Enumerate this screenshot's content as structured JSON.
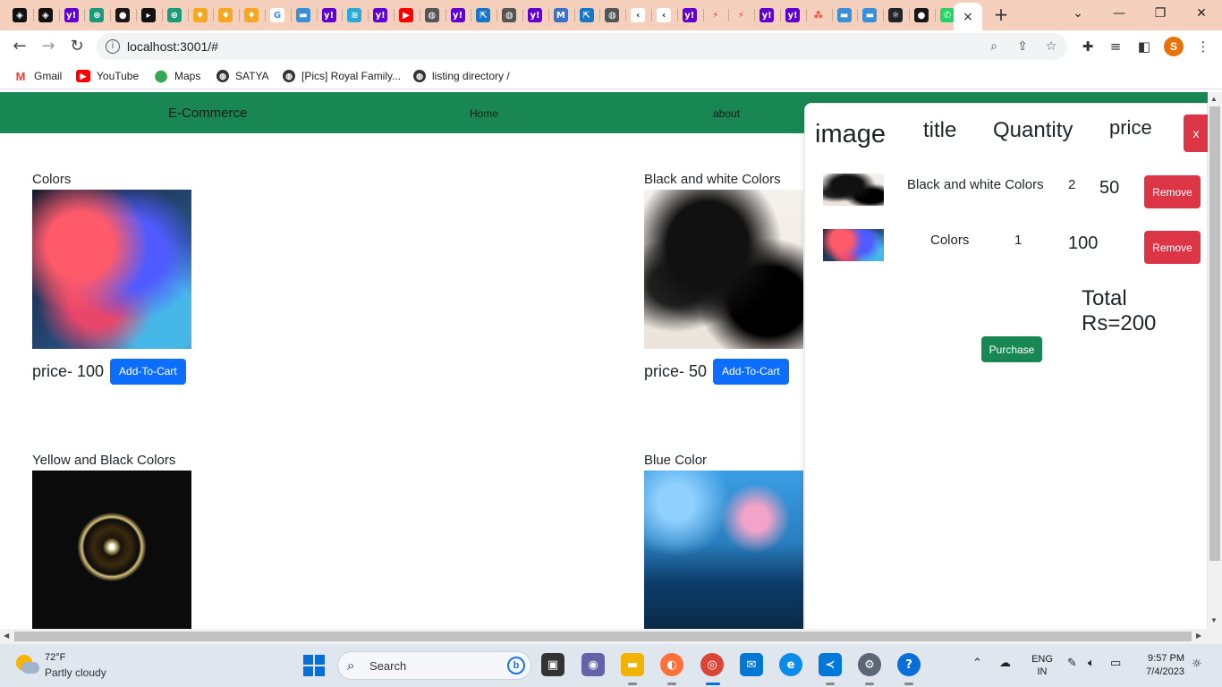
{
  "browser": {
    "tab_icons": [
      "codepen-icon",
      "codepen-icon",
      "yahoo-icon",
      "openai-icon",
      "github-icon",
      "terminal-icon",
      "openai-icon",
      "fire-icon",
      "fire-icon",
      "fire-icon",
      "google-icon",
      "bar-icon",
      "yahoo-icon",
      "wave-icon",
      "yahoo-icon",
      "youtube-icon",
      "globe-icon",
      "yahoo-icon",
      "share-icon",
      "globe-icon",
      "yahoo-icon",
      "mdb-icon",
      "share-icon",
      "globe-icon",
      "code-icon",
      "code-icon",
      "yahoo-icon",
      "bolt-icon",
      "bolt-icon",
      "yahoo-icon",
      "yahoo-icon",
      "dots-icon",
      "bar-icon",
      "bar-icon",
      "react-icon",
      "github-icon",
      "whatsapp-icon"
    ],
    "active_tab_close": "×",
    "new_tab": "+",
    "window_controls": {
      "dropdown": "⌄",
      "minimize": "—",
      "restore": "❐",
      "close": "✕"
    },
    "back": "←",
    "forward": "→",
    "reload": "↻",
    "url": "localhost:3001/#",
    "profile_initial": "S",
    "bookmarks": [
      {
        "label": "Gmail",
        "icon": "gmail-icon",
        "color": "#ea4335"
      },
      {
        "label": "YouTube",
        "icon": "youtube-icon",
        "color": "#ff0000"
      },
      {
        "label": "Maps",
        "icon": "maps-icon",
        "color": "#34a853"
      },
      {
        "label": "SATYA",
        "icon": "globe-icon",
        "color": "#333333"
      },
      {
        "label": "[Pics] Royal Family...",
        "icon": "globe-icon",
        "color": "#333333"
      },
      {
        "label": "listing directory /",
        "icon": "globe-icon",
        "color": "#333333"
      }
    ]
  },
  "page": {
    "brand": "E-Commerce",
    "nav": {
      "home": "Home",
      "about": "about"
    },
    "products": [
      {
        "title": "Colors",
        "price": "price- 100",
        "button": "Add-To-Cart"
      },
      {
        "title": "Black and white Colors",
        "price": "price- 50",
        "button": "Add-To-Cart"
      },
      {
        "title": "Yellow and Black Colors"
      },
      {
        "title": "Blue Color"
      }
    ]
  },
  "cart": {
    "headers": {
      "image": "image",
      "title": "title",
      "quantity": "Quantity",
      "price": "price"
    },
    "close": "x",
    "items": [
      {
        "title": "Black and white Colors",
        "qty": "2",
        "price": "50",
        "remove": "Remove"
      },
      {
        "title": "Colors",
        "qty": "1",
        "price": "100",
        "remove": "Remove"
      }
    ],
    "total": "Total Rs=200",
    "purchase": "Purchase"
  },
  "taskbar": {
    "temp": "72°F",
    "condition": "Partly cloudy",
    "search": "Search",
    "lang_1": "ENG",
    "lang_2": "IN",
    "time": "9:57 PM",
    "date": "7/4/2023"
  },
  "colors": {
    "navbar": "#198754",
    "danger": "#dc3545",
    "primary": "#0d6efd",
    "tabstrip": "#f5d0bd"
  }
}
